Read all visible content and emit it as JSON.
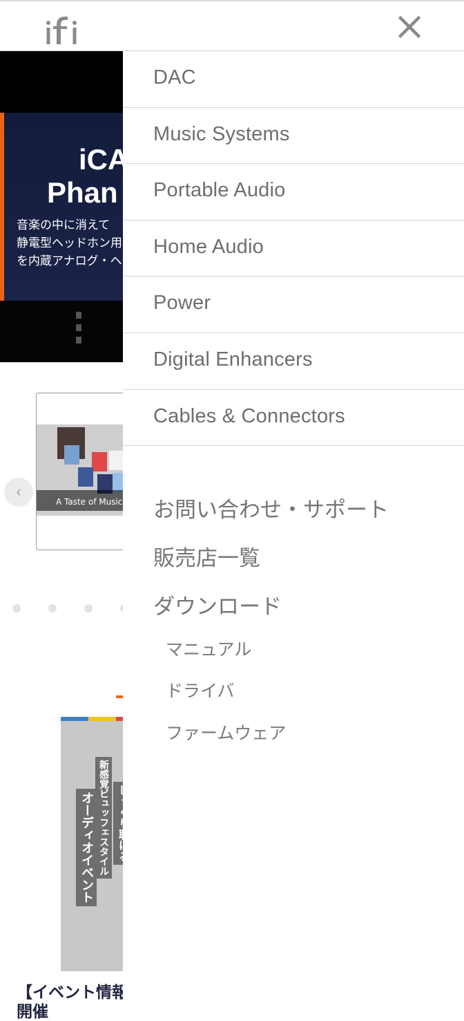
{
  "header": {
    "logo_text": "ifi",
    "close_icon": "close-icon"
  },
  "background": {
    "hero": {
      "title_line1": "iCA",
      "title_line2": "Phan",
      "desc_line1": "音楽の中に消えて",
      "desc_line2": "静電型ヘッドホン用",
      "desc_line3": "を内蔵アナログ・ヘ"
    },
    "carousel": {
      "caption": "A Taste of Music",
      "prev_icon": "chevron-left-icon"
    },
    "event": {
      "title_line1": "【イベント情報",
      "title_line2": "開催",
      "vertical_text_1": "新感覚ビュッフェスタイル",
      "vertical_text_2": "オーディオイベント",
      "vertical_text_3": "じっくり聴ける"
    }
  },
  "menu": {
    "categories": [
      {
        "label": "DAC"
      },
      {
        "label": "Music Systems"
      },
      {
        "label": "Portable Audio"
      },
      {
        "label": "Home Audio"
      },
      {
        "label": "Power"
      },
      {
        "label": "Digital Enhancers"
      },
      {
        "label": "Cables & Connectors"
      }
    ],
    "links": {
      "support": "お問い合わせ・サポート",
      "dealers": "販売店一覧",
      "download": "ダウンロード"
    },
    "download_sub": {
      "manual": "マニュアル",
      "driver": "ドライバ",
      "firmware": "ファームウェア"
    }
  },
  "colors": {
    "accent": "#e8641b",
    "menu_text": "#6e6e6e",
    "hero_panel": "#141c3c"
  }
}
